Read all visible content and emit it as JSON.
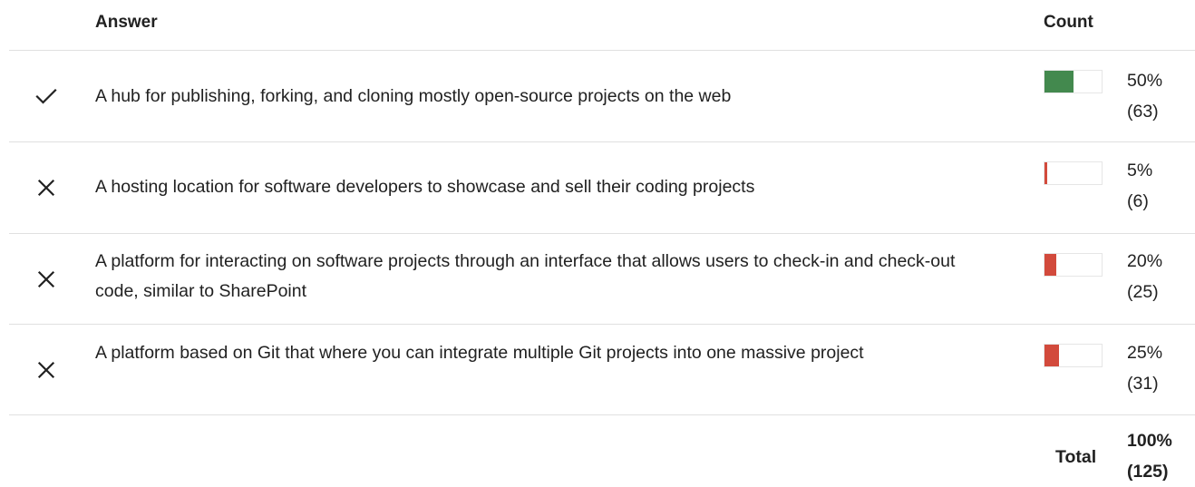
{
  "header": {
    "answer_label": "Answer",
    "count_label": "Count"
  },
  "colors": {
    "correct_fill": "#43894e",
    "incorrect_fill": "#d24a3c",
    "divider": "#e0e0e0"
  },
  "answers": [
    {
      "status": "correct",
      "icon": "check-icon",
      "text": "A hub for publishing, forking, and cloning mostly open-source projects on the web",
      "percent_label": "50%",
      "count_label": "(63)",
      "fraction": 0.5
    },
    {
      "status": "incorrect",
      "icon": "close-icon",
      "text": "A hosting location for software developers to showcase and sell their coding projects",
      "percent_label": "5%",
      "count_label": "(6)",
      "fraction": 0.05
    },
    {
      "status": "incorrect",
      "icon": "close-icon",
      "text": "A platform for interacting on software projects through an interface that allows users to check-in and check-out code, similar to SharePoint",
      "percent_label": "20%",
      "count_label": "(25)",
      "fraction": 0.2
    },
    {
      "status": "incorrect",
      "icon": "close-icon",
      "text": "A platform based on Git that where you can integrate multiple Git projects into one massive project",
      "percent_label": "25%",
      "count_label": "(31)",
      "fraction": 0.25
    }
  ],
  "total": {
    "label": "Total",
    "percent_label": "100%",
    "count_label": "(125)"
  }
}
